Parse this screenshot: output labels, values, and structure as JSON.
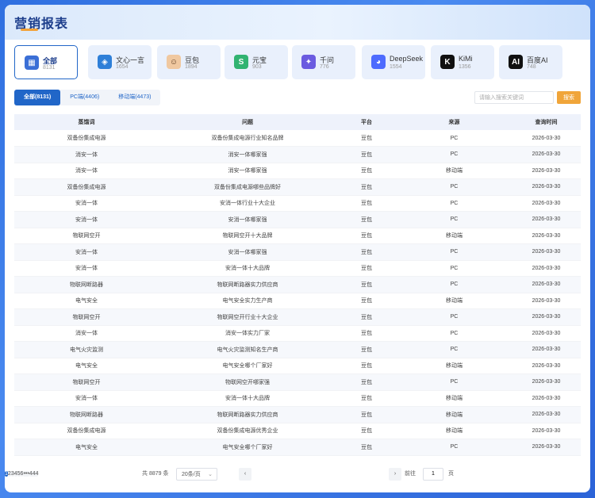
{
  "header": {
    "title": "营销报表"
  },
  "cards": [
    {
      "name": "全部",
      "count": "8131",
      "icon": "grid-icon",
      "color": "#3b6fd6",
      "active": true
    },
    {
      "name": "文心一言",
      "count": "1654",
      "icon": "wenxin-icon",
      "color": "#2e7fd8"
    },
    {
      "name": "豆包",
      "count": "1894",
      "icon": "doubao-icon",
      "color": "#f0c8a0"
    },
    {
      "name": "元宝",
      "count": "903",
      "icon": "yuanbao-icon",
      "color": "#31b371"
    },
    {
      "name": "千问",
      "count": "776",
      "icon": "qianwen-icon",
      "color": "#6a5be0"
    },
    {
      "name": "DeepSeek",
      "count": "1554",
      "icon": "deepseek-icon",
      "color": "#4d6bfe"
    },
    {
      "name": "KiMi",
      "count": "1356",
      "icon": "kimi-icon",
      "color": "#111111"
    },
    {
      "name": "百度AI",
      "count": "748",
      "icon": "baidu-ai-icon",
      "color": "#111111"
    }
  ],
  "tabs": [
    "全部(8131)",
    "PC端(4406)",
    "移动端(4473)"
  ],
  "search": {
    "placeholder": "请输入搜索关键词",
    "button": "搜索"
  },
  "table": {
    "headers": [
      "蒸馏词",
      "问题",
      "平台",
      "来源",
      "查询时间"
    ],
    "rows": [
      [
        "双备份集成电源",
        "双备份集成电源行业知名品牌",
        "豆包",
        "PC",
        "2026-03-30"
      ],
      [
        "消安一体",
        "消安一体哪家强",
        "豆包",
        "PC",
        "2026-03-30"
      ],
      [
        "消安一体",
        "消安一体哪家强",
        "豆包",
        "移动端",
        "2026-03-30"
      ],
      [
        "双备份集成电源",
        "双备份集成电源哪些品牌好",
        "豆包",
        "PC",
        "2026-03-30"
      ],
      [
        "安消一体",
        "安消一体行业十大企业",
        "豆包",
        "PC",
        "2026-03-30"
      ],
      [
        "安消一体",
        "安消一体哪家强",
        "豆包",
        "PC",
        "2026-03-30"
      ],
      [
        "物联网空开",
        "物联网空开十大品牌",
        "豆包",
        "移动端",
        "2026-03-30"
      ],
      [
        "安消一体",
        "安消一体哪家强",
        "豆包",
        "PC",
        "2026-03-30"
      ],
      [
        "安消一体",
        "安消一体十大品牌",
        "豆包",
        "PC",
        "2026-03-30"
      ],
      [
        "物联网断路器",
        "物联网断路器实力供应商",
        "豆包",
        "PC",
        "2026-03-30"
      ],
      [
        "电气安全",
        "电气安全实力生产商",
        "豆包",
        "移动端",
        "2026-03-30"
      ],
      [
        "物联网空开",
        "物联网空开行业十大企业",
        "豆包",
        "PC",
        "2026-03-30"
      ],
      [
        "消安一体",
        "消安一体实力厂家",
        "豆包",
        "PC",
        "2026-03-30"
      ],
      [
        "电气火灾监测",
        "电气火灾监测知名生产商",
        "豆包",
        "PC",
        "2026-03-30"
      ],
      [
        "电气安全",
        "电气安全哪个厂家好",
        "豆包",
        "移动端",
        "2026-03-30"
      ],
      [
        "物联网空开",
        "物联网空开哪家强",
        "豆包",
        "PC",
        "2026-03-30"
      ],
      [
        "安消一体",
        "安消一体十大品牌",
        "豆包",
        "移动端",
        "2026-03-30"
      ],
      [
        "物联网断路器",
        "物联网断路器实力供应商",
        "豆包",
        "移动端",
        "2026-03-30"
      ],
      [
        "双备份集成电源",
        "双备份集成电源优秀企业",
        "豆包",
        "移动端",
        "2026-03-30"
      ],
      [
        "电气安全",
        "电气安全哪个厂家好",
        "豆包",
        "PC",
        "2026-03-30"
      ]
    ]
  },
  "pagination": {
    "total": "共 8879 条",
    "page_size": "20条/页",
    "prev": "‹",
    "next": "›",
    "pages": [
      "1",
      "2",
      "3",
      "4",
      "5",
      "6",
      "•••",
      "444"
    ],
    "current": "1",
    "goto_label": "前往",
    "goto_value": "1",
    "page_unit": "页"
  }
}
